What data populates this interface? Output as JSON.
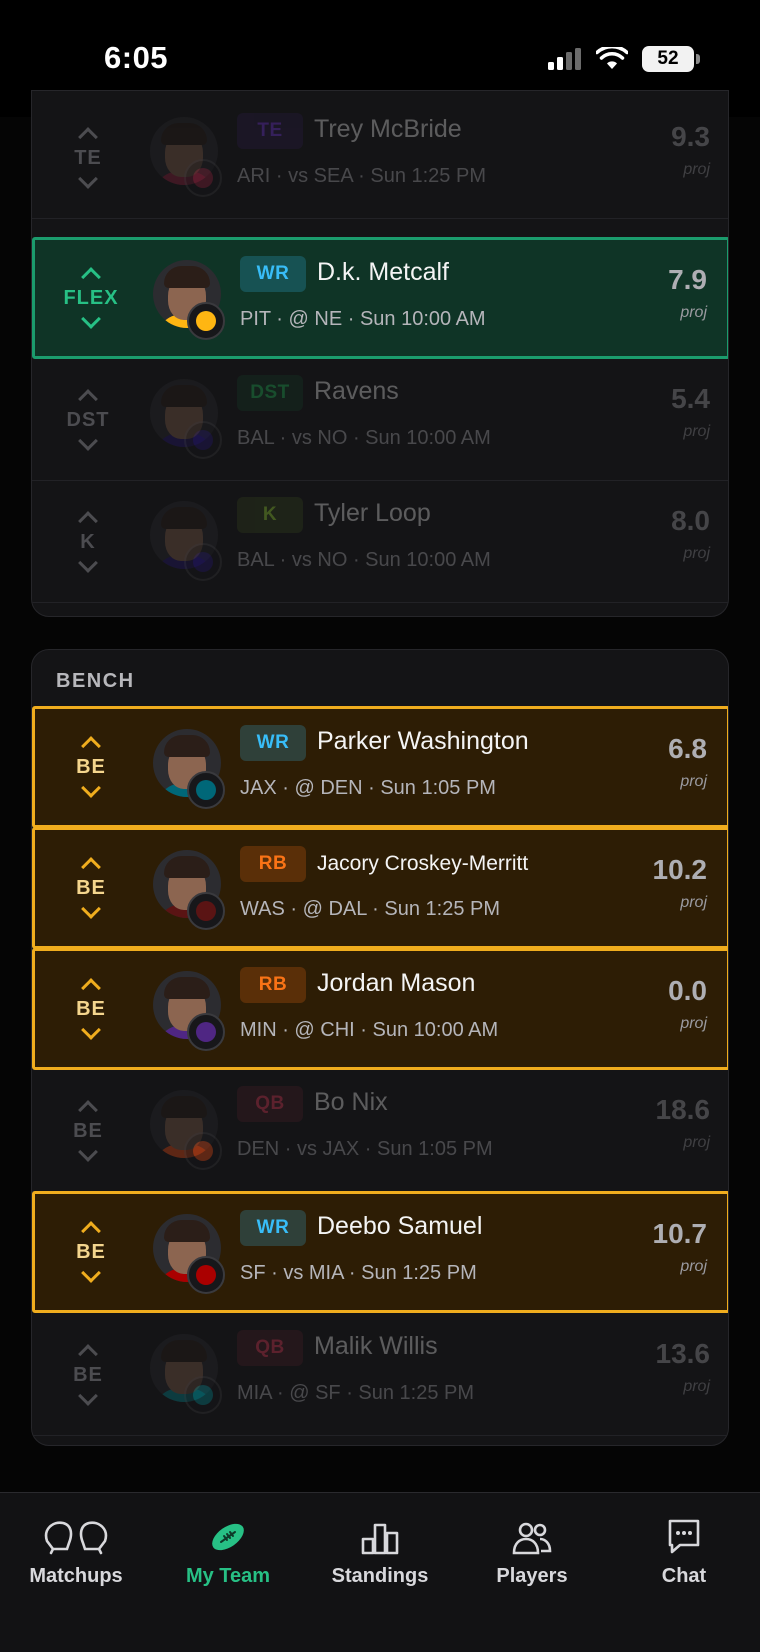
{
  "status_bar": {
    "time": "6:05",
    "battery": "52"
  },
  "starters": [
    {
      "slot": "TE",
      "pos": "TE",
      "name": "Trey McBride",
      "game": "ARI · vs SEA · Sun 1:25 PM",
      "proj": "9.3",
      "proj_label": "proj",
      "state": "dim",
      "pos_color": "#7c3aed",
      "team_color": "#97233f"
    },
    {
      "slot": "FLEX",
      "pos": "WR",
      "name": "D.k. Metcalf",
      "game": "PIT · @ NE · Sun 10:00 AM",
      "proj": "7.9",
      "proj_label": "proj",
      "state": "flex",
      "pos_color": "#38bdf8",
      "team_color": "#ffb612"
    },
    {
      "slot": "DST",
      "pos": "DST",
      "name": "Ravens",
      "game": "BAL · vs NO · Sun 10:00 AM",
      "proj": "5.4",
      "proj_label": "proj",
      "state": "dim",
      "pos_color": "#22c55e",
      "team_color": "#241773"
    },
    {
      "slot": "K",
      "pos": "K",
      "name": "Tyler Loop",
      "game": "BAL · vs NO · Sun 10:00 AM",
      "proj": "8.0",
      "proj_label": "proj",
      "state": "dim",
      "pos_color": "#a3e635",
      "team_color": "#241773"
    }
  ],
  "bench": {
    "title": "BENCH",
    "players": [
      {
        "slot": "BE",
        "pos": "WR",
        "name": "Parker Washington",
        "game": "JAX · @ DEN · Sun 1:05 PM",
        "proj": "6.8",
        "proj_label": "proj",
        "state": "bench",
        "pos_color": "#38bdf8",
        "team_color": "#006778"
      },
      {
        "slot": "BE",
        "pos": "RB",
        "name": "Jacory Croskey-Merritt",
        "game": "WAS · @ DAL · Sun 1:25 PM",
        "proj": "10.2",
        "proj_label": "proj",
        "state": "bench",
        "pos_color": "#f97316",
        "team_color": "#5a1414"
      },
      {
        "slot": "BE",
        "pos": "RB",
        "name": "Jordan Mason",
        "game": "MIN · @ CHI · Sun 10:00 AM",
        "proj": "0.0",
        "proj_label": "proj",
        "state": "bench",
        "pos_color": "#f97316",
        "team_color": "#4f2683"
      },
      {
        "slot": "BE",
        "pos": "QB",
        "name": "Bo Nix",
        "game": "DEN · vs JAX · Sun 1:05 PM",
        "proj": "18.6",
        "proj_label": "proj",
        "state": "dim",
        "pos_color": "#f43f5e",
        "team_color": "#fb4f14"
      },
      {
        "slot": "BE",
        "pos": "WR",
        "name": "Deebo Samuel",
        "game": "SF · vs MIA · Sun 1:25 PM",
        "proj": "10.7",
        "proj_label": "proj",
        "state": "bench",
        "pos_color": "#38bdf8",
        "team_color": "#aa0000"
      },
      {
        "slot": "BE",
        "pos": "QB",
        "name": "Malik Willis",
        "game": "MIA · @ SF · Sun 1:25 PM",
        "proj": "13.6",
        "proj_label": "proj",
        "state": "dim",
        "pos_color": "#f43f5e",
        "team_color": "#008e97"
      }
    ]
  },
  "nav": [
    {
      "label": "Matchups",
      "icon": "matchups-icon",
      "active": false
    },
    {
      "label": "My Team",
      "icon": "football-icon",
      "active": true
    },
    {
      "label": "Standings",
      "icon": "standings-icon",
      "active": false
    },
    {
      "label": "Players",
      "icon": "players-icon",
      "active": false
    },
    {
      "label": "Chat",
      "icon": "chat-icon",
      "active": false
    }
  ],
  "colors": {
    "flex_accent": "#27c085",
    "bench_accent": "#f0ad1e",
    "background": "#050505"
  }
}
